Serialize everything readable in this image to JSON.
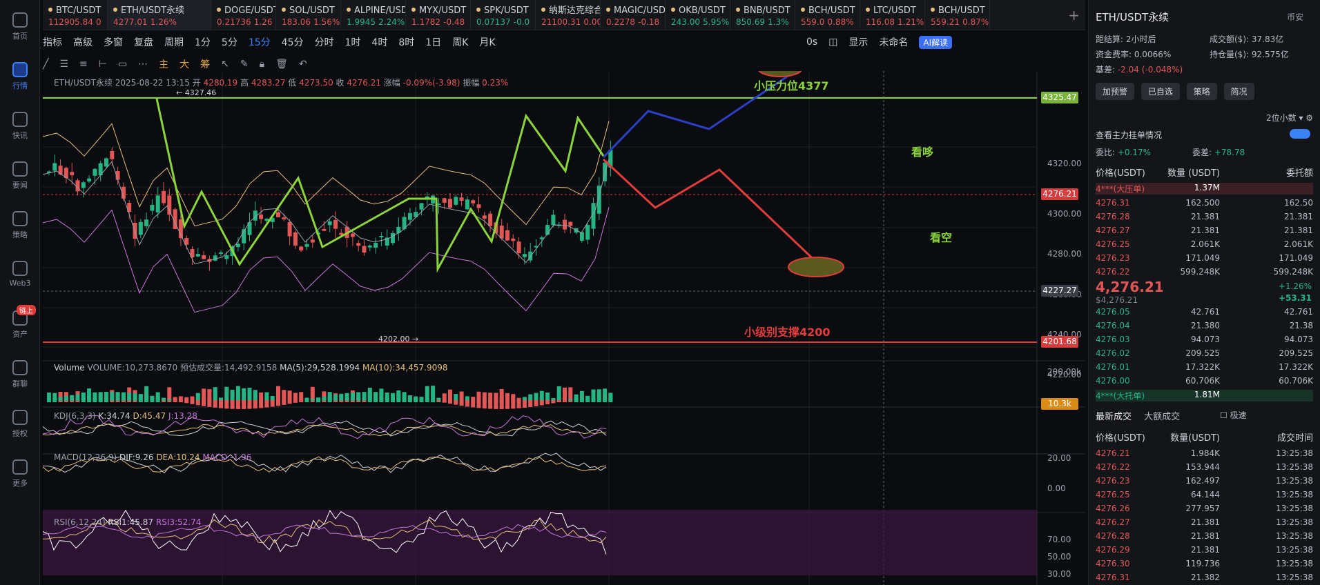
{
  "nav": [
    {
      "label": "首页"
    },
    {
      "label": "行情",
      "active": true
    },
    {
      "label": "快讯"
    },
    {
      "label": "要闻"
    },
    {
      "label": "策略"
    },
    {
      "label": "Web3"
    },
    {
      "label": "资产",
      "badge": "链上"
    },
    {
      "label": "群聊"
    },
    {
      "label": "授权"
    },
    {
      "label": "更多"
    }
  ],
  "tabs": [
    {
      "name": "BTC/USDT",
      "price": "112905.84",
      "chg": "0",
      "up": false
    },
    {
      "name": "ETH/USDT永续",
      "price": "4277.01",
      "chg": "1.26%",
      "up": false,
      "active": true
    },
    {
      "name": "DOGE/USDT",
      "price": "0.21736",
      "chg": "1.26",
      "up": false
    },
    {
      "name": "SOL/USDT",
      "price": "183.06",
      "chg": "1.56%",
      "up": false
    },
    {
      "name": "ALPINE/USDT",
      "price": "1.9945",
      "chg": "2.24%",
      "up": true
    },
    {
      "name": "MYX/USDT",
      "price": "1.1782",
      "chg": "-0.48",
      "up": false
    },
    {
      "name": "SPK/USDT",
      "price": "0.07137",
      "chg": "-0.0",
      "up": true
    },
    {
      "name": "纳斯达克综合指",
      "price": "21100.31",
      "chg": "0.00%",
      "up": null
    },
    {
      "name": "MAGIC/USDT",
      "price": "0.2278",
      "chg": "-0.18",
      "up": false
    },
    {
      "name": "OKB/USDT",
      "price": "243.00",
      "chg": "5.95%",
      "up": true
    },
    {
      "name": "BNB/USDT",
      "price": "850.69",
      "chg": "1.3%",
      "up": true
    },
    {
      "name": "BCH/USDT",
      "price": "559.0",
      "chg": "0.88%",
      "up": false
    },
    {
      "name": "LTC/USDT",
      "price": "116.08",
      "chg": "1.21%",
      "up": false
    },
    {
      "name": "BCH/USDT",
      "price": "559.21",
      "chg": "0.87%",
      "up": false
    }
  ],
  "toolbar": {
    "items": [
      "指标",
      "高级",
      "多窗",
      "复盘",
      "周期",
      "1分",
      "5分",
      "15分",
      "45分",
      "分时",
      "1时",
      "4时",
      "8时",
      "1日",
      "周K",
      "月K"
    ],
    "selected": "15分",
    "right": [
      "0s",
      "显示",
      "未命名",
      "AI解读"
    ]
  },
  "draw_tools": [
    "主",
    "大",
    "筹"
  ],
  "info": {
    "symbol": "ETH/USDT永续",
    "datetime": "2025-08-22 13:15",
    "open": "4280.19",
    "high": "4283.27",
    "low": "4273.50",
    "close": "4276.21",
    "change": "-0.09%(-3.98)",
    "amp": "0.23%"
  },
  "price_axis": [
    "4320.00",
    "4300.00",
    "4280.00",
    "4260.00",
    "4240.00",
    "4220.00"
  ],
  "tags": {
    "resist": "4325.47",
    "last": "4276.21",
    "cross": "4227.27",
    "support": "4201.68",
    "vol": "10.3k"
  },
  "marks": {
    "high": "← 4327.46",
    "low": "4202.00 →"
  },
  "annotations": {
    "resist": "小压力位4377",
    "bull": "看哆",
    "bear": "看空",
    "support": "小级别支撑4200"
  },
  "volume": {
    "label": "Volume",
    "vol": "VOLUME:10,273.8670",
    "est": "预估成交量:14,492.9158",
    "ma5": "MA(5):29,528.1994",
    "ma10": "MA(10):34,457.9098",
    "axis": "200.00k"
  },
  "kdj": {
    "label": "KDJ(6,3,3)",
    "k": "K:34.74",
    "d": "D:45.47",
    "j": "J:13.28"
  },
  "macd": {
    "label": "MACD(12,26,9)",
    "dif": "DIF:9.26",
    "dea": "DEA:10.24",
    "macd": "MACD:-1.96",
    "axis": [
      "20.00",
      "0.00"
    ]
  },
  "rsi": {
    "label": "RSI(6,12,24)",
    "r1": "RSI1:45.87",
    "r3": "RSI3:52.74",
    "axis": [
      "70.00",
      "50.00",
      "30.00"
    ]
  },
  "panel": {
    "title": "ETH/USDT永续",
    "currency": "币安",
    "funding_left": "距结算: 2小时后",
    "rate": "资金费率: 0.0066%",
    "basis_label": "基差:",
    "basis": "-2.04 (-0.048%)",
    "turnover": "成交额($): 37.83亿",
    "oi": "持仓量($): 92.575亿",
    "buttons": [
      "加预警",
      "已自选",
      "策略",
      "简况"
    ],
    "depth": "2位小数",
    "mm": "查看主力挂单情况",
    "ratio_l": "委比: ",
    "ratio_lv": "+0.17%",
    "diff_l": "委差: ",
    "diff_lv": "+78.78",
    "headers": [
      "价格(USDT)",
      "数量 (USDT)",
      "委托额"
    ],
    "big_ask": {
      "p": "4***(大压单)",
      "v": "1.37M"
    },
    "asks": [
      [
        "4276.31",
        "162.500",
        "162.50"
      ],
      [
        "4276.28",
        "21.381",
        "21.381"
      ],
      [
        "4276.27",
        "21.381",
        "21.381"
      ],
      [
        "4276.25",
        "2.061K",
        "2.061K"
      ],
      [
        "4276.23",
        "171.049",
        "171.049"
      ],
      [
        "4276.22",
        "599.248K",
        "599.248K"
      ]
    ],
    "last": "4,276.21",
    "last_sub": "$4,276.21",
    "last_pct": "+1.26%",
    "last_chg": "+53.31",
    "bids": [
      [
        "4276.05",
        "42.761",
        "42.761"
      ],
      [
        "4276.04",
        "21.380",
        "21.38"
      ],
      [
        "4276.03",
        "94.073",
        "94.073"
      ],
      [
        "4276.02",
        "209.525",
        "209.525"
      ],
      [
        "4276.01",
        "17.322K",
        "17.322K"
      ],
      [
        "4276.00",
        "60.706K",
        "60.706K"
      ]
    ],
    "big_bid": {
      "p": "4***(大托单)",
      "v": "1.81M"
    },
    "trades_tabs": [
      "最新成交",
      "大额成交"
    ],
    "trades_opt": "极速",
    "trade_headers": [
      "价格(USDT)",
      "数量(USDT)",
      "成交时间"
    ],
    "trades": [
      [
        "4276.21",
        "1.984K",
        "13:25:38"
      ],
      [
        "4276.22",
        "153.944",
        "13:25:38"
      ],
      [
        "4276.23",
        "162.497",
        "13:25:38"
      ],
      [
        "4276.25",
        "64.144",
        "13:25:38"
      ],
      [
        "4276.26",
        "277.957",
        "13:25:38"
      ],
      [
        "4276.27",
        "21.381",
        "13:25:38"
      ],
      [
        "4276.28",
        "21.381",
        "13:25:38"
      ],
      [
        "4276.29",
        "21.381",
        "13:25:38"
      ],
      [
        "4276.30",
        "119.736",
        "13:25:38"
      ],
      [
        "4276.31",
        "21.382",
        "13:25:38"
      ]
    ]
  }
}
